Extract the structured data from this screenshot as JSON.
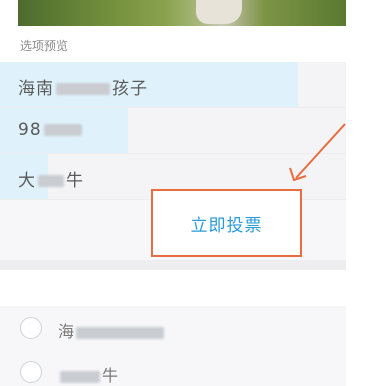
{
  "preview": {
    "section_label": "选项预览",
    "options": [
      {
        "label_prefix": "海南",
        "label_suffix": "孩子",
        "fill_fraction": 0.86
      },
      {
        "label_prefix": "98",
        "label_suffix": "",
        "fill_fraction": 0.37
      },
      {
        "label_prefix": "大",
        "label_suffix": "牛",
        "fill_fraction": 0.14
      }
    ]
  },
  "vote": {
    "button_label": "立即投票"
  },
  "choices": [
    {
      "label_prefix": "海",
      "label_suffix": ""
    },
    {
      "label_prefix": "",
      "label_suffix": "牛"
    }
  ],
  "colors": {
    "accent_text": "#2a9bd9",
    "annotation": "#e86d3f",
    "fill": "#dff2fb"
  }
}
